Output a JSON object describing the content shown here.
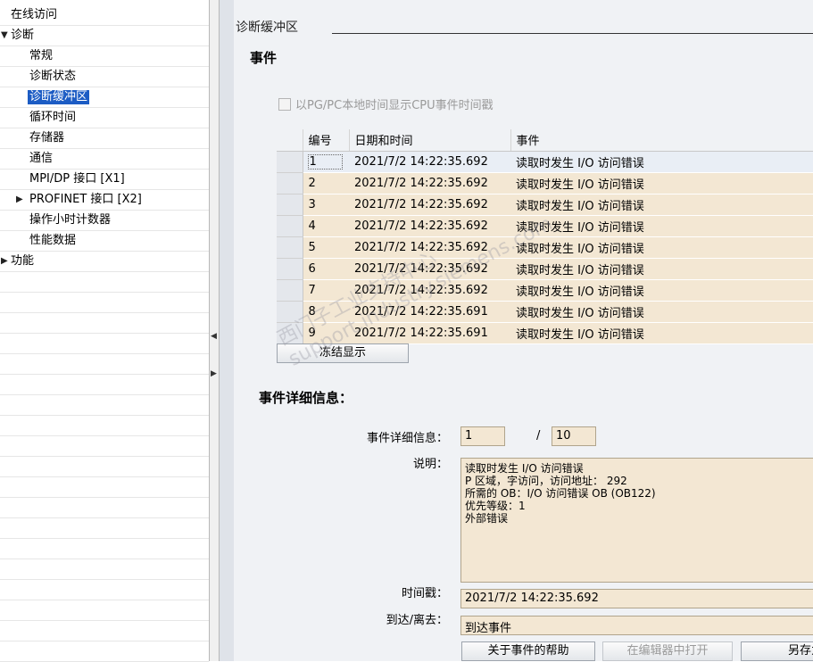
{
  "tree": {
    "online_access": "在线访问",
    "diagnostics": "诊断",
    "general": "常规",
    "diagnostic_status": "诊断状态",
    "diagnostic_buffer": "诊断缓冲区",
    "cycle_time": "循环时间",
    "memory": "存储器",
    "communication": "通信",
    "mpi_dp": "MPI/DP 接口 [X1]",
    "profinet": "PROFINET 接口 [X2]",
    "operating_hours": "操作小时计数器",
    "performance_data": "性能数据",
    "functions": "功能"
  },
  "panel": {
    "buffer_title": "诊断缓冲区",
    "events_title": "事件",
    "checkbox_label": "以PG/PC本地时间显示CPU事件时间戳",
    "table_headers": [
      "编号",
      "日期和时间",
      "事件"
    ],
    "rows": [
      {
        "num": "1",
        "datetime": "2021/7/2 14:22:35.692",
        "event": "读取时发生 I/O 访问错误"
      },
      {
        "num": "2",
        "datetime": "2021/7/2 14:22:35.692",
        "event": "读取时发生 I/O 访问错误"
      },
      {
        "num": "3",
        "datetime": "2021/7/2 14:22:35.692",
        "event": "读取时发生 I/O 访问错误"
      },
      {
        "num": "4",
        "datetime": "2021/7/2 14:22:35.692",
        "event": "读取时发生 I/O 访问错误"
      },
      {
        "num": "5",
        "datetime": "2021/7/2 14:22:35.692",
        "event": "读取时发生 I/O 访问错误"
      },
      {
        "num": "6",
        "datetime": "2021/7/2 14:22:35.692",
        "event": "读取时发生 I/O 访问错误"
      },
      {
        "num": "7",
        "datetime": "2021/7/2 14:22:35.692",
        "event": "读取时发生 I/O 访问错误"
      },
      {
        "num": "8",
        "datetime": "2021/7/2 14:22:35.691",
        "event": "读取时发生 I/O 访问错误"
      },
      {
        "num": "9",
        "datetime": "2021/7/2 14:22:35.691",
        "event": "读取时发生 I/O 访问错误"
      }
    ],
    "freeze_button": "冻结显示",
    "details_title": "事件详细信息：",
    "details_label": "事件详细信息：",
    "details_index": "1",
    "details_sep": "/",
    "details_total": "10",
    "description_label": "说明：",
    "description_lines": [
      "读取时发生 I/O 访问错误",
      "P 区域，字访问，访问地址：  292",
      "所需的 OB：I/O 访问错误 OB (OB122)",
      "优先等级：1",
      "外部错误"
    ],
    "timestamp_label": "时间戳：",
    "timestamp_value": "2021/7/2 14:22:35.692",
    "arrival_label": "到达/离去：",
    "arrival_value": "到达事件",
    "help_button": "关于事件的帮助",
    "open_editor_button": "在编辑器中打开",
    "save_as_button": "另存为"
  },
  "watermark": [
    "西门子工业支持中心",
    "support.industry.siemens.com"
  ]
}
